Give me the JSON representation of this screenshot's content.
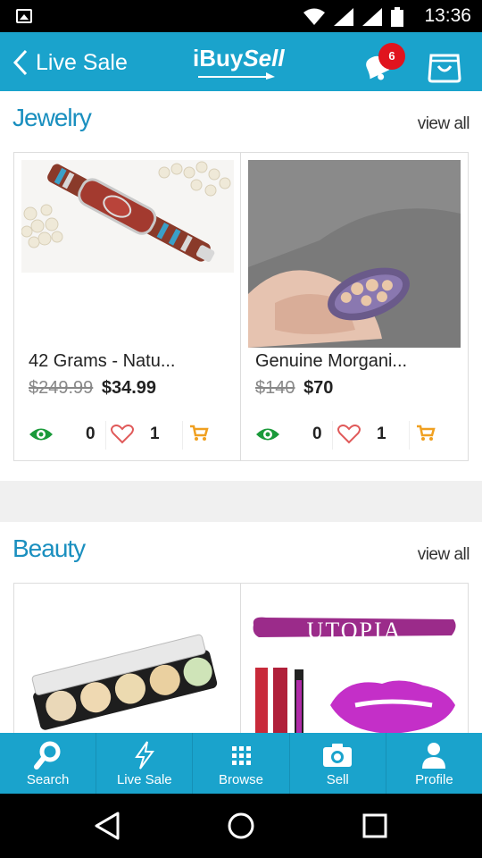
{
  "status_bar": {
    "time": "13:36"
  },
  "header": {
    "back_label": "Live Sale",
    "logo_prefix": "iBuy",
    "logo_suffix": "Sell",
    "notification_count": "6"
  },
  "sections": [
    {
      "title": "Jewelry",
      "view_all": "view all",
      "products": [
        {
          "name": "42 Grams - Natu...",
          "old_price": "$249.99",
          "price": "$34.99",
          "views": "0",
          "likes": "1"
        },
        {
          "name": "Genuine Morgani...",
          "old_price": "$140",
          "price": "$70",
          "views": "0",
          "likes": "1"
        }
      ]
    },
    {
      "title": "Beauty",
      "view_all": "view all",
      "products": [
        {
          "banner_text": "UTOPIA"
        }
      ]
    }
  ],
  "bottom_nav": [
    {
      "label": "Search",
      "icon": "search-icon"
    },
    {
      "label": "Live Sale",
      "icon": "lightning-icon"
    },
    {
      "label": "Browse",
      "icon": "grid-icon"
    },
    {
      "label": "Sell",
      "icon": "camera-icon"
    },
    {
      "label": "Profile",
      "icon": "person-icon"
    }
  ],
  "colors": {
    "brand": "#1aa3cc",
    "section_title": "#1a8fbf",
    "badge": "#e0141e",
    "eye": "#1a9a3a",
    "cart_small": "#f0a020"
  }
}
